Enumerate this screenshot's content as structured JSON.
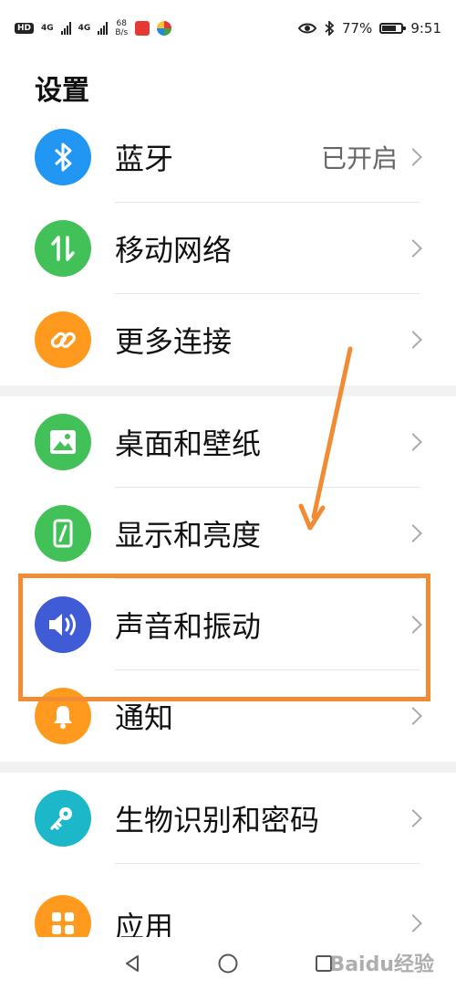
{
  "status_bar": {
    "hd_label": "HD",
    "network1": "4G",
    "network2": "4G",
    "speed_value": "68",
    "speed_unit": "B/s",
    "battery_text": "77%",
    "battery_level": 0.77,
    "time": "9:51"
  },
  "page": {
    "title": "设置"
  },
  "groups": [
    {
      "items": [
        {
          "key": "bluetooth",
          "label": "蓝牙",
          "value": "已开启",
          "icon": "bluetooth-icon",
          "color": "#2196f3"
        },
        {
          "key": "mobile-network",
          "label": "移动网络",
          "value": "",
          "icon": "mobile-data-icon",
          "color": "#43c159"
        },
        {
          "key": "more-connections",
          "label": "更多连接",
          "value": "",
          "icon": "link-icon",
          "color": "#ff9a1f"
        }
      ]
    },
    {
      "items": [
        {
          "key": "home-wallpaper",
          "label": "桌面和壁纸",
          "value": "",
          "icon": "image-icon",
          "color": "#43c159"
        },
        {
          "key": "display-brightness",
          "label": "显示和亮度",
          "value": "",
          "icon": "phone-brightness-icon",
          "color": "#43c159"
        },
        {
          "key": "sound-vibration",
          "label": "声音和振动",
          "value": "",
          "icon": "speaker-icon",
          "color": "#3f5bd6"
        },
        {
          "key": "notifications",
          "label": "通知",
          "value": "",
          "icon": "bell-icon",
          "color": "#ff9a1f"
        }
      ]
    },
    {
      "items": [
        {
          "key": "biometrics-password",
          "label": "生物识别和密码",
          "value": "",
          "icon": "key-icon",
          "color": "#1cb8c9"
        },
        {
          "key": "apps",
          "label": "应用",
          "value": "",
          "icon": "apps-grid-icon",
          "color": "#ff9a1f"
        }
      ]
    }
  ],
  "nav": {
    "back": "back-icon",
    "home": "home-icon",
    "recents": "recents-icon"
  },
  "watermark": {
    "text": "Baidu经验"
  },
  "accent_color": "#f28c34"
}
